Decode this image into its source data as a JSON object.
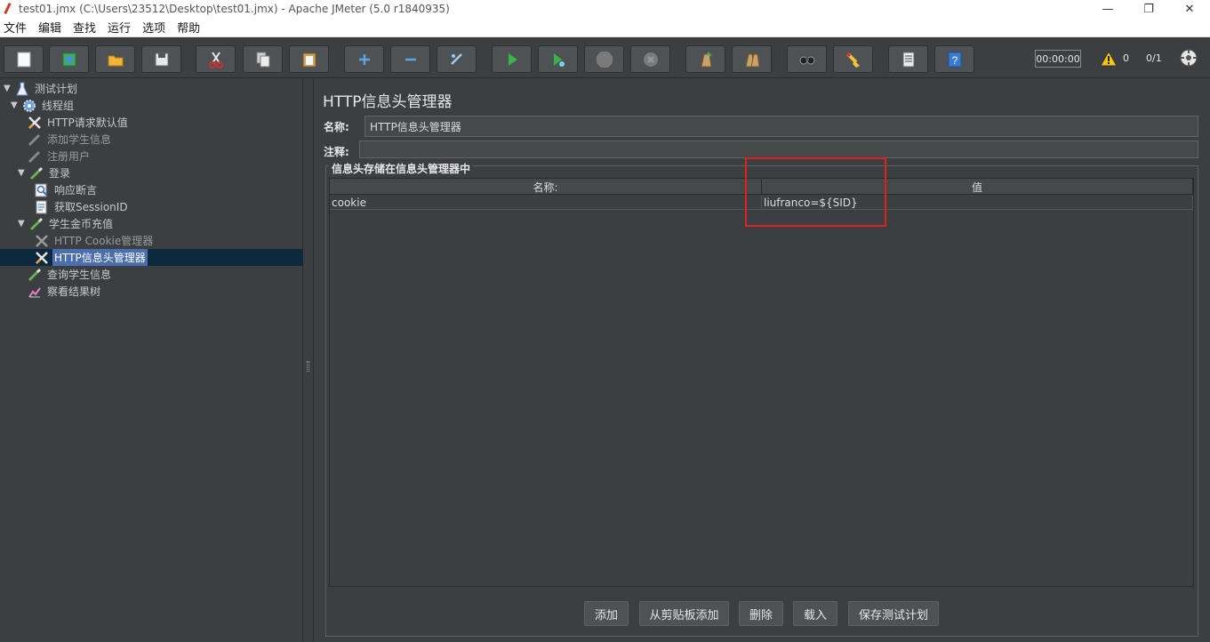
{
  "window": {
    "title": "test01.jmx (C:\\Users\\23512\\Desktop\\test01.jmx) - Apache JMeter (5.0 r1840935)",
    "minimize": "—",
    "maximize": "❐",
    "close": "✕"
  },
  "menu": [
    "文件",
    "编辑",
    "查找",
    "运行",
    "选项",
    "帮助"
  ],
  "toolbar": {
    "buttons": [
      "new-icon",
      "templates-icon",
      "open-icon",
      "save-icon",
      "cut-icon",
      "copy-icon",
      "paste-icon",
      "expand-icon",
      "collapse-icon",
      "toggle-icon",
      "start-icon",
      "start-no-pause-icon",
      "stop-icon",
      "shutdown-icon",
      "clear-icon",
      "clear-all-icon",
      "search-icon",
      "reset-search-icon",
      "function-helper-icon",
      "help-icon"
    ],
    "timer": "00:00:00",
    "warnings": "0",
    "threads": "0/1"
  },
  "tree": {
    "test_plan": "测试计划",
    "thread_group": "线程组",
    "http_defaults": "HTTP请求默认值",
    "add_student": "添加学生信息",
    "register_user": "注册用户",
    "login": "登录",
    "response_assertion": "响应断言",
    "get_session": "获取SessionID",
    "student_recharge": "学生金币充值",
    "cookie_manager": "HTTP Cookie管理器",
    "header_manager": "HTTP信息头管理器",
    "query_student": "查询学生信息",
    "result_tree": "察看结果树"
  },
  "panel": {
    "title": "HTTP信息头管理器",
    "name_label": "名称:",
    "name_value": "HTTP信息头管理器",
    "comment_label": "注释:",
    "comment_value": "",
    "group_title": "信息头存储在信息头管理器中",
    "table": {
      "headers": [
        "名称:",
        "值"
      ],
      "rows": [
        {
          "name": "cookie",
          "value": "liufranco=${SID}"
        }
      ]
    },
    "buttons": {
      "add": "添加",
      "add_clipboard": "从剪贴板添加",
      "delete": "删除",
      "load": "载入",
      "save_plan": "保存测试计划"
    }
  },
  "colors": {
    "background": "#3c3f41",
    "selection": "#4b6eaf",
    "highlight_box": "#e0201a"
  }
}
